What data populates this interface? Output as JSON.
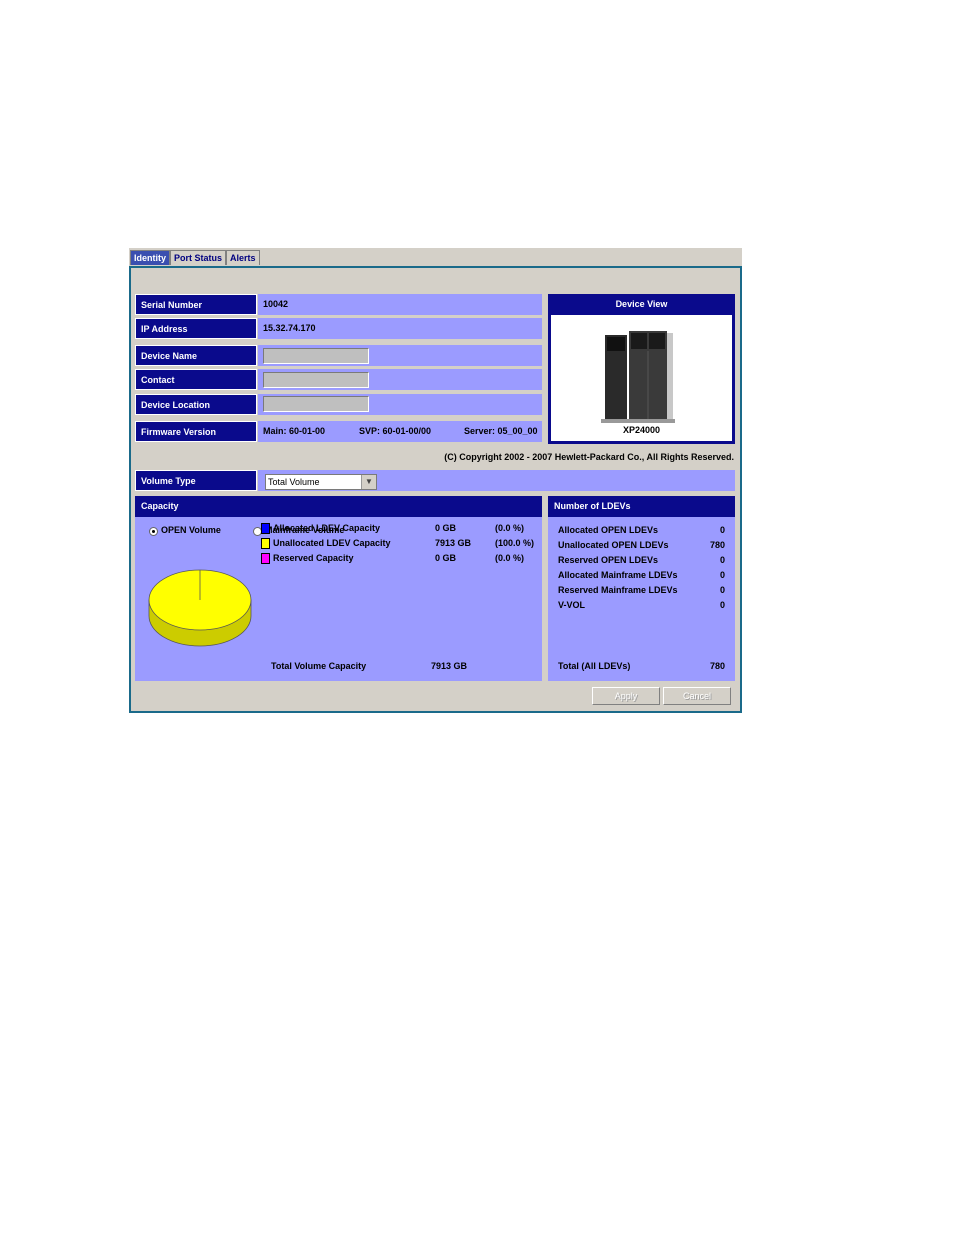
{
  "tabs": [
    "Identity",
    "Port Status",
    "Alerts"
  ],
  "identity": {
    "serial_number": {
      "label": "Serial Number",
      "value": "10042"
    },
    "ip_address": {
      "label": "IP Address",
      "value": "15.32.74.170"
    },
    "device_name": {
      "label": "Device Name",
      "value": ""
    },
    "contact": {
      "label": "Contact",
      "value": ""
    },
    "device_location": {
      "label": "Device Location",
      "value": ""
    },
    "firmware": {
      "label": "Firmware Version",
      "main": "Main: 60-01-00",
      "svp": "SVP: 60-01-00/00",
      "server": "Server: 05_00_00"
    }
  },
  "device_view": {
    "title": "Device View",
    "model": "XP24000"
  },
  "copyright": "(C) Copyright 2002 - 2007 Hewlett-Packard Co., All Rights Reserved.",
  "volume_type": {
    "label": "Volume Type",
    "selected": "Total Volume"
  },
  "capacity": {
    "title": "Capacity",
    "radio_open": "OPEN Volume",
    "radio_mainframe": "Mainframe Volume",
    "selected": "OPEN Volume",
    "legend": [
      {
        "label": "Allocated LDEV Capacity",
        "size": "0 GB",
        "pct": "(0.0 %)",
        "color": "#0000ff"
      },
      {
        "label": "Unallocated LDEV Capacity",
        "size": "7913 GB",
        "pct": "(100.0 %)",
        "color": "#ffff00"
      },
      {
        "label": "Reserved Capacity",
        "size": "0 GB",
        "pct": "(0.0 %)",
        "color": "#ff00ff"
      }
    ],
    "total_label": "Total Volume Capacity",
    "total_value": "7913 GB"
  },
  "ldevs": {
    "title": "Number of LDEVs",
    "rows": [
      {
        "label": "Allocated OPEN LDEVs",
        "value": "0"
      },
      {
        "label": "Unallocated OPEN LDEVs",
        "value": "780"
      },
      {
        "label": "Reserved OPEN LDEVs",
        "value": "0"
      },
      {
        "label": "Allocated Mainframe LDEVs",
        "value": "0"
      },
      {
        "label": "Reserved Mainframe LDEVs",
        "value": "0"
      },
      {
        "label": "V-VOL",
        "value": "0"
      }
    ],
    "total_label": "Total (All LDEVs)",
    "total_value": "780"
  },
  "buttons": {
    "apply": "Apply",
    "cancel": "Cancel"
  },
  "colors": {
    "header": "#0a0a8c",
    "panel": "#9b9bff",
    "pie_fill": "#ffff00"
  }
}
